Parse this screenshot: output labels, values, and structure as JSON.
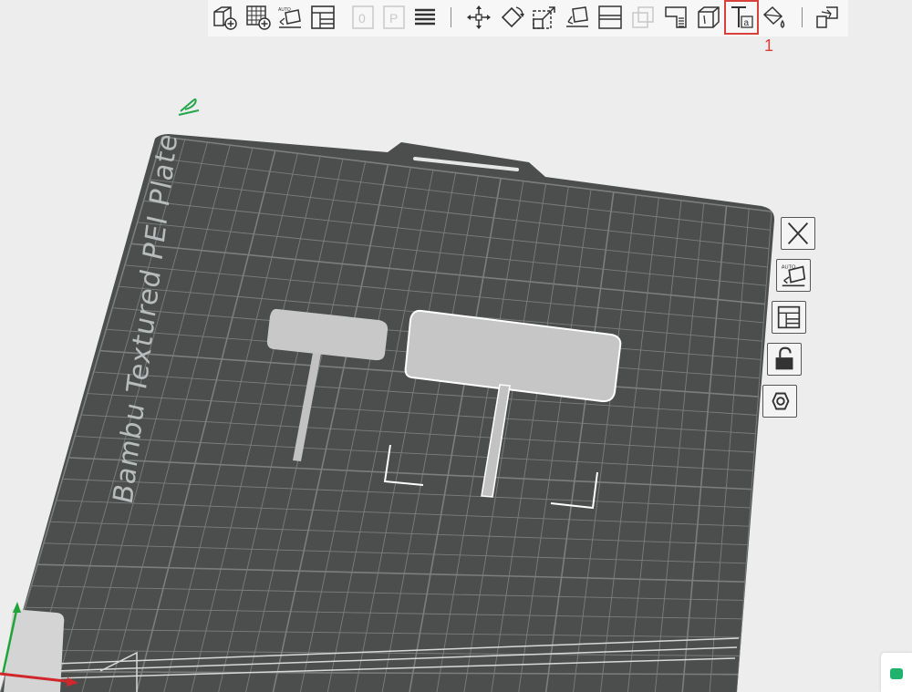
{
  "toolbar": {
    "tools": [
      {
        "id": "add",
        "icon": "add-cube-icon",
        "label": "Add"
      },
      {
        "id": "add-plate",
        "icon": "add-plate-icon",
        "label": "Add plate"
      },
      {
        "id": "auto-orient",
        "icon": "auto-orient-icon",
        "label": "Auto orient",
        "badge": "AUTO"
      },
      {
        "id": "arrange",
        "icon": "arrange-icon",
        "label": "Arrange"
      },
      {
        "id": "part-disabled",
        "icon": "plate-0-icon",
        "label": "0"
      },
      {
        "id": "plate-disabled",
        "icon": "plate-p-icon",
        "label": "P"
      },
      {
        "id": "layers",
        "icon": "layers-icon",
        "label": "Layers"
      },
      {
        "id": "move",
        "icon": "move-icon",
        "label": "Move"
      },
      {
        "id": "rotate",
        "icon": "rotate-icon",
        "label": "Rotate"
      },
      {
        "id": "scale",
        "icon": "scale-icon",
        "label": "Scale"
      },
      {
        "id": "lay-on-face",
        "icon": "lay-on-face-icon",
        "label": "Lay on face"
      },
      {
        "id": "cut",
        "icon": "cut-icon",
        "label": "Cut"
      },
      {
        "id": "boolean",
        "icon": "boolean-icon",
        "label": "Boolean"
      },
      {
        "id": "support-paint",
        "icon": "support-paint-icon",
        "label": "Support painting"
      },
      {
        "id": "seam-paint",
        "icon": "seam-paint-icon",
        "label": "Seam painting"
      },
      {
        "id": "text",
        "icon": "text-tool-icon",
        "label": "Text",
        "active": true
      },
      {
        "id": "color-paint",
        "icon": "color-paint-icon",
        "label": "Color painting"
      },
      {
        "id": "assembly",
        "icon": "assembly-icon",
        "label": "Assembly"
      }
    ],
    "highlight_color": "#d9403a"
  },
  "annotation": {
    "step_marker": "1"
  },
  "plate": {
    "label": "Bambu Textured PEI Plate",
    "surface_color": "#4b4e4d",
    "grid_color": "#7b7e7d",
    "label_color": "#b9bcbc"
  },
  "plate_toolbar": {
    "buttons": [
      {
        "icon": "close-icon",
        "label": "Delete plate"
      },
      {
        "icon": "auto-orient-icon",
        "label": "Auto orient",
        "badge": "AUTO"
      },
      {
        "icon": "arrange-icon",
        "label": "Arrange"
      },
      {
        "icon": "unlock-icon",
        "label": "Lock plate"
      },
      {
        "icon": "hexagon-settings-icon",
        "label": "Plate settings"
      }
    ]
  },
  "objects": [
    {
      "name": "sign-small",
      "color": "#c8c8c8"
    },
    {
      "name": "sign-large",
      "color": "#c8c8c8",
      "selected": true
    }
  ],
  "axes": {
    "x_color": "#d0282a",
    "y_color": "#1fa43a"
  }
}
